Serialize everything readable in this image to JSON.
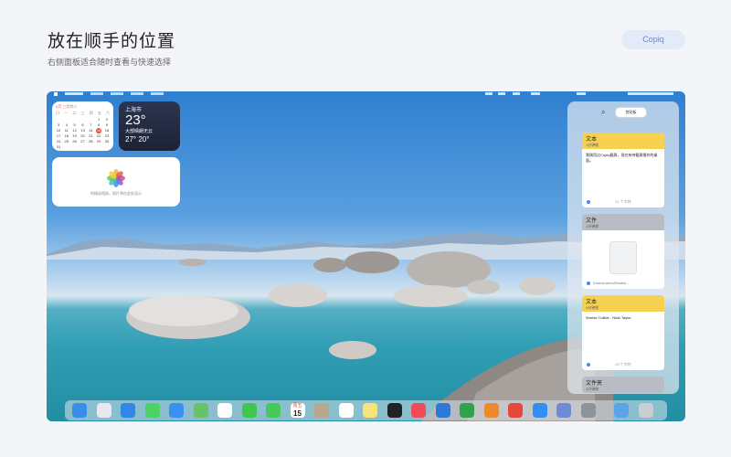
{
  "hero": {
    "title": "放在顺手的位置",
    "subtitle": "右侧面板适合随时查看与快速选择"
  },
  "brand": {
    "label": "Copiq"
  },
  "calendar": {
    "month": "6月  三月廿八",
    "weekdays": [
      "日",
      "一",
      "二",
      "三",
      "四",
      "五",
      "六"
    ],
    "rows": [
      [
        "",
        "",
        "",
        "",
        "",
        "1",
        "2"
      ],
      [
        "3",
        "4",
        "5",
        "6",
        "7",
        "8",
        "9"
      ],
      [
        "10",
        "11",
        "12",
        "13",
        "14",
        "15",
        "16"
      ],
      [
        "17",
        "18",
        "19",
        "20",
        "21",
        "22",
        "23"
      ],
      [
        "24",
        "25",
        "26",
        "27",
        "28",
        "29",
        "30"
      ],
      [
        "31",
        "",
        "",
        "",
        "",
        "",
        ""
      ]
    ],
    "today": "15"
  },
  "weather": {
    "city": "上海市",
    "temp": "23°",
    "condition": "大部晴朗无云",
    "range": "27° 20°"
  },
  "photos": {
    "caption": "你精选相册，照片将在此处显示"
  },
  "panel": {
    "search_icon": "search-icon",
    "chip_label": "剪贴板",
    "cards": [
      {
        "type": "文本",
        "time": "1分钟前",
        "body": "我刚用过Copiq截屏，现在有待截屏操作的桌面。",
        "footer": "21 个字符",
        "color": "#f6d14f"
      },
      {
        "type": "文件",
        "time": "1分钟前",
        "path": "/Users/users/Deskto...",
        "color": "#b9bcc2"
      },
      {
        "type": "文本",
        "time": "4分钟前",
        "body": "Worlds Collide - Nicki Taylor",
        "footer": "29 个字符",
        "color": "#f6d14f"
      },
      {
        "type": "文件夹",
        "time": "4分钟前",
        "color": "#b9bcc2"
      }
    ]
  },
  "dock": {
    "calendar_month": "周五",
    "calendar_day": "15",
    "apps": [
      {
        "name": "finder-icon",
        "color": "#3a8ee8"
      },
      {
        "name": "launchpad-icon",
        "color": "#e8e8ef"
      },
      {
        "name": "safari-icon",
        "color": "#2f88e6"
      },
      {
        "name": "messages-icon",
        "color": "#4cd364"
      },
      {
        "name": "mail-icon",
        "color": "#3b8ff0"
      },
      {
        "name": "maps-icon",
        "color": "#68c26a"
      },
      {
        "name": "photos-icon",
        "color": "#ffffff"
      },
      {
        "name": "facetime-icon",
        "color": "#3ec64f"
      },
      {
        "name": "phone-icon",
        "color": "#46c95a"
      },
      {
        "name": "calendar-icon",
        "color": "#ffffff"
      },
      {
        "name": "contacts-icon",
        "color": "#b9a88e"
      },
      {
        "name": "reminders-icon",
        "color": "#ffffff"
      },
      {
        "name": "notes-icon",
        "color": "#f9e27a"
      },
      {
        "name": "tv-icon",
        "color": "#222222"
      },
      {
        "name": "music-icon",
        "color": "#f24a5a"
      },
      {
        "name": "keynote-icon",
        "color": "#2e78d6"
      },
      {
        "name": "numbers-icon",
        "color": "#2fa24a"
      },
      {
        "name": "pages-icon",
        "color": "#ee8a2a"
      },
      {
        "name": "rocket-icon",
        "color": "#e7463b"
      },
      {
        "name": "appstore-icon",
        "color": "#2f8ff2"
      },
      {
        "name": "preview-icon",
        "color": "#6f8bd6"
      },
      {
        "name": "settings-icon",
        "color": "#8e9399"
      },
      {
        "name": "folder-icon",
        "color": "#5aa5e8"
      },
      {
        "name": "trash-icon",
        "color": "#c9ced5"
      }
    ]
  }
}
